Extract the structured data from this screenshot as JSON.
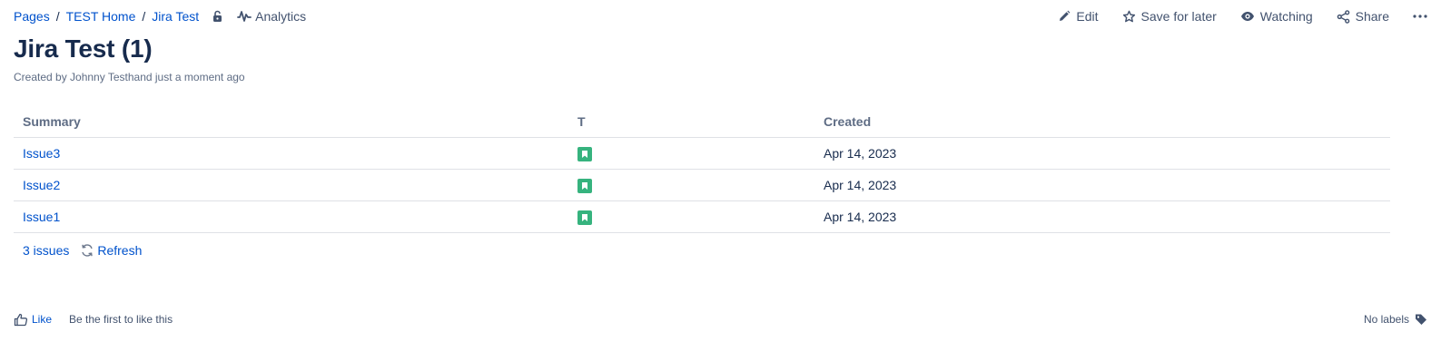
{
  "breadcrumb": {
    "items": [
      "Pages",
      "TEST Home",
      "Jira Test"
    ],
    "separator": "/"
  },
  "header": {
    "lock_icon": "unlocked-icon",
    "analytics_label": "Analytics"
  },
  "actions": {
    "edit_label": "Edit",
    "save_label": "Save for later",
    "watching_label": "Watching",
    "share_label": "Share"
  },
  "page": {
    "title": "Jira Test (1)",
    "byline": "Created by Johnny Testhand just a moment ago"
  },
  "table": {
    "columns": [
      "Summary",
      "T",
      "Created"
    ],
    "rows": [
      {
        "summary": "Issue3",
        "type_icon": "story-icon",
        "created": "Apr 14, 2023"
      },
      {
        "summary": "Issue2",
        "type_icon": "story-icon",
        "created": "Apr 14, 2023"
      },
      {
        "summary": "Issue1",
        "type_icon": "story-icon",
        "created": "Apr 14, 2023"
      }
    ],
    "count_label": "3 issues",
    "refresh_label": "Refresh"
  },
  "footer": {
    "like_label": "Like",
    "like_text": "Be the first to like this",
    "labels_text": "No labels"
  },
  "colors": {
    "link": "#0052cc",
    "text": "#172b4d",
    "muted": "#5e6c84",
    "story_green": "#36b37e",
    "border": "#dfe1e6"
  }
}
